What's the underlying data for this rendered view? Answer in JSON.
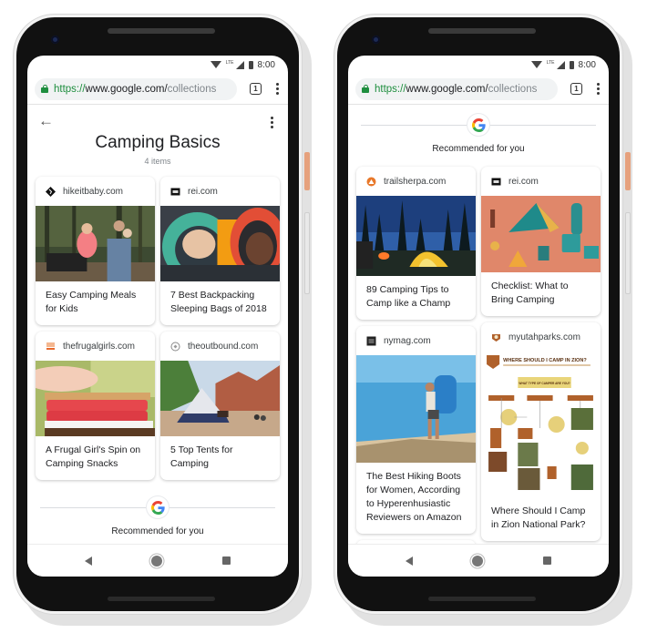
{
  "status_bar": {
    "time": "8:00",
    "network": "LTE"
  },
  "browser": {
    "url_scheme": "https://",
    "url_host": "www.google.com/",
    "url_path": "collections",
    "tab_count": "1",
    "icons": {
      "lock": "lock-icon",
      "menu": "kebab-menu-icon",
      "tabs": "tab-switcher-icon"
    }
  },
  "nav_bar": {
    "icons": [
      "back-triangle-icon",
      "home-circle-icon",
      "recents-square-icon"
    ]
  },
  "screen1": {
    "header": {
      "title": "Camping Basics",
      "subtitle": "4 items",
      "back_icon": "arrow-left-icon",
      "menu_icon": "kebab-menu-icon"
    },
    "columns": [
      [
        {
          "source": "hikeitbaby.com",
          "favicon": "hikeitbaby-logo",
          "title": "Easy Camping Meals for Kids",
          "image": "family camping in forest"
        },
        {
          "source": "thefrugalgirls.com",
          "favicon": "frugalgirls-logo",
          "title": "A Frugal Girl's Spin on Camping Snacks",
          "image": "strawberry s'mores"
        }
      ],
      [
        {
          "source": "rei.com",
          "favicon": "rei-logo",
          "title": "7 Best Backpacking Sleeping Bags of 2018",
          "image": "couple in sleeping bags"
        },
        {
          "source": "theoutbound.com",
          "favicon": "theoutbound-logo",
          "title": "5 Top Tents for Camping",
          "image": "tent in canyon"
        }
      ]
    ],
    "recommended_label": "Recommended for you"
  },
  "screen2": {
    "recommended_label": "Recommended for you",
    "columns": [
      [
        {
          "source": "trailsherpa.com",
          "favicon": "trailsherpa-logo",
          "title": "89 Camping Tips to Camp like a Champ",
          "image": "tent at night by campfire"
        },
        {
          "source": "nymag.com",
          "favicon": "nymag-logo",
          "title": "The Best Hiking Boots for Women, According to Hyperenhusiastic Reviewers on Amazon",
          "image": "hiker with backpack by lake"
        }
      ],
      [
        {
          "source": "rei.com",
          "favicon": "rei-logo",
          "title": "Checklist: What to Bring Camping",
          "image": "camping gear illustration"
        },
        {
          "source": "myutahparks.com",
          "favicon": "myutahparks-logo",
          "title": "Where Should I Camp in Zion National Park?",
          "image": "Where should I camp in Zion flowchart",
          "image_heading": "WHERE SHOULD I CAMP IN ZION?",
          "image_question": "WHAT TYPE OF CAMPER ARE YOU?"
        }
      ]
    ]
  }
}
